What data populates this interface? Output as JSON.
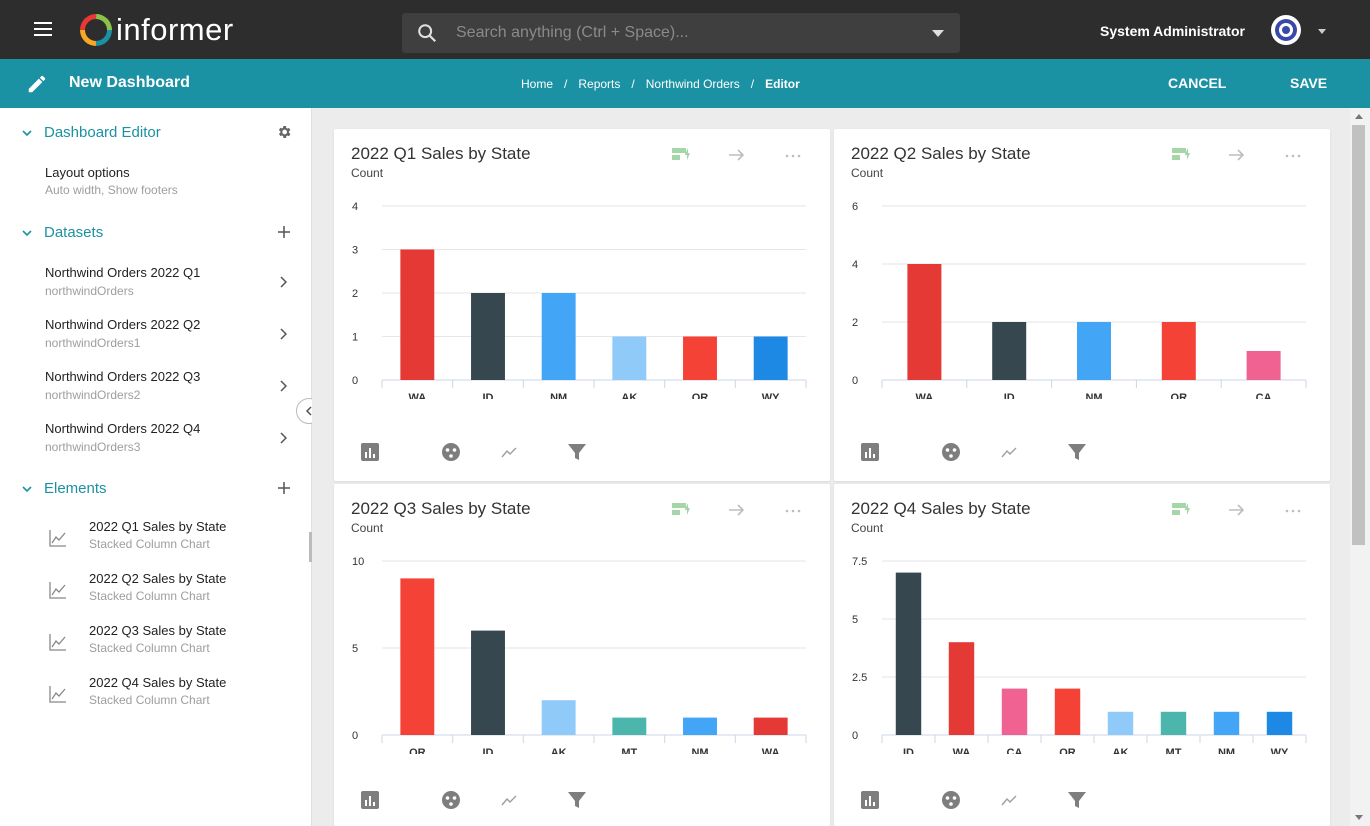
{
  "app": {
    "logo_text": "informer"
  },
  "search": {
    "placeholder": "Search anything (Ctrl + Space)..."
  },
  "user": {
    "name": "System Administrator"
  },
  "subbar": {
    "title": "New Dashboard",
    "breadcrumb": [
      "Home",
      "Reports",
      "Northwind Orders",
      "Editor"
    ],
    "cancel_label": "CANCEL",
    "save_label": "SAVE"
  },
  "sidebar": {
    "editor_heading": "Dashboard Editor",
    "layout": {
      "title": "Layout options",
      "subtitle": "Auto width, Show footers"
    },
    "datasets_heading": "Datasets",
    "datasets": [
      {
        "title": "Northwind Orders 2022 Q1",
        "subtitle": "northwindOrders"
      },
      {
        "title": "Northwind Orders 2022 Q2",
        "subtitle": "northwindOrders1"
      },
      {
        "title": "Northwind Orders 2022 Q3",
        "subtitle": "northwindOrders2"
      },
      {
        "title": "Northwind Orders 2022 Q4",
        "subtitle": "northwindOrders3"
      }
    ],
    "elements_heading": "Elements",
    "elements": [
      {
        "title": "2022 Q1 Sales by State",
        "subtitle": "Stacked Column Chart"
      },
      {
        "title": "2022 Q2 Sales by State",
        "subtitle": "Stacked Column Chart"
      },
      {
        "title": "2022 Q3 Sales by State",
        "subtitle": "Stacked Column Chart"
      },
      {
        "title": "2022 Q4 Sales by State",
        "subtitle": "Stacked Column Chart"
      }
    ]
  },
  "colors": {
    "teal": "#1b91a4",
    "topbar": "#2d2d2d",
    "WA": "#e53935",
    "ID": "#37474f",
    "NM": "#42a5f5",
    "AK": "#90caf9",
    "OR": "#f44336",
    "WY": "#1e88e5",
    "CA": "#f06292",
    "MT": "#4db6ac"
  },
  "icons": {
    "menu": "hamburger-icon",
    "search": "search-icon",
    "settings": "gear-icon",
    "add": "plus-icon",
    "chart_line": "line-chart-icon",
    "filter": "filter-icon"
  },
  "chart_data": [
    {
      "type": "bar",
      "title": "2022 Q1 Sales by State",
      "ylabel": "Count",
      "categories": [
        "WA",
        "ID",
        "NM",
        "AK",
        "OR",
        "WY"
      ],
      "values": [
        3,
        2,
        2,
        1,
        1,
        1
      ],
      "ylim": [
        0,
        4
      ],
      "yticks": [
        "0",
        "1",
        "2",
        "3",
        "4"
      ],
      "colors": [
        "#e53935",
        "#37474f",
        "#42a5f5",
        "#90caf9",
        "#f44336",
        "#1e88e5"
      ]
    },
    {
      "type": "bar",
      "title": "2022 Q2 Sales by State",
      "ylabel": "Count",
      "categories": [
        "WA",
        "ID",
        "NM",
        "OR",
        "CA"
      ],
      "values": [
        4,
        2,
        2,
        2,
        1
      ],
      "ylim": [
        0,
        6
      ],
      "yticks": [
        "0",
        "2",
        "4",
        "6"
      ],
      "colors": [
        "#e53935",
        "#37474f",
        "#42a5f5",
        "#f44336",
        "#f06292"
      ]
    },
    {
      "type": "bar",
      "title": "2022 Q3 Sales by State",
      "ylabel": "Count",
      "categories": [
        "OR",
        "ID",
        "AK",
        "MT",
        "NM",
        "WA"
      ],
      "values": [
        9,
        6,
        2,
        1,
        1,
        1
      ],
      "ylim": [
        0,
        10
      ],
      "yticks": [
        "0",
        "5",
        "10"
      ],
      "colors": [
        "#f44336",
        "#37474f",
        "#90caf9",
        "#4db6ac",
        "#42a5f5",
        "#e53935"
      ]
    },
    {
      "type": "bar",
      "title": "2022 Q4 Sales by State",
      "ylabel": "Count",
      "categories": [
        "ID",
        "WA",
        "CA",
        "OR",
        "AK",
        "MT",
        "NM",
        "WY"
      ],
      "values": [
        7,
        4,
        2,
        2,
        1,
        1,
        1,
        1
      ],
      "ylim": [
        0,
        7.5
      ],
      "yticks": [
        "0",
        "2.5",
        "5",
        "7.5"
      ],
      "colors": [
        "#37474f",
        "#e53935",
        "#f06292",
        "#f44336",
        "#90caf9",
        "#4db6ac",
        "#42a5f5",
        "#1e88e5"
      ]
    }
  ]
}
